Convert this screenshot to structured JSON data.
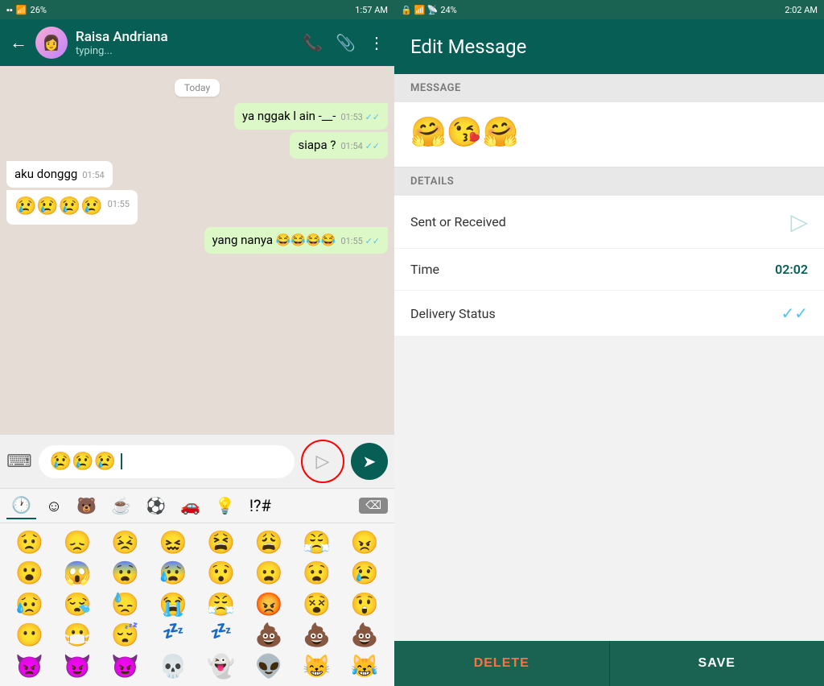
{
  "left": {
    "statusBar": {
      "left": "1:57 AM",
      "battery": "26%",
      "signal": "WiFi"
    },
    "topBar": {
      "contactName": "Raisa Andriana",
      "status": "typing...",
      "backIcon": "←",
      "callIcon": "📞",
      "attachIcon": "📎",
      "moreIcon": "⋮"
    },
    "todayLabel": "Today",
    "messages": [
      {
        "id": 1,
        "type": "sent",
        "text": "ya nggak l",
        "extra": "ain -__-",
        "time": "01:53",
        "ticks": "✓✓"
      },
      {
        "id": 2,
        "type": "sent",
        "text": "siapa ?",
        "time": "01:54",
        "ticks": "✓✓"
      },
      {
        "id": 3,
        "type": "received",
        "text": "aku donggg",
        "time": "01:54"
      },
      {
        "id": 4,
        "type": "received",
        "text": "😢😢😢😢",
        "time": "01:55"
      },
      {
        "id": 5,
        "type": "sent",
        "text": "yang nanya 😂😂😂😂",
        "time": "01:55",
        "ticks": "✓✓"
      }
    ],
    "inputBar": {
      "emojis": "😢😢😢",
      "stickerPlaceholder": "▷",
      "sendIcon": "➤",
      "keyboardIcon": "⌨"
    },
    "emojiTabs": [
      "🕐",
      "☺",
      "🐻",
      "☕",
      "⚽",
      "🚗",
      "💡",
      "!?#",
      "⌫"
    ],
    "emojiRows": [
      [
        "😟",
        "😞",
        "😣",
        "😖",
        "😫",
        "😩",
        "😤",
        "😠"
      ],
      [
        "😮",
        "😱",
        "😨",
        "😰",
        "😯",
        "😦",
        "😧",
        "😢"
      ],
      [
        "😥",
        "😪",
        "😓",
        "😭",
        "😤",
        "😡",
        "😵",
        "😲"
      ],
      [
        "😶",
        "😷",
        "😴",
        "💤",
        "💤",
        "💩",
        "💩",
        "💩"
      ],
      [
        "👿",
        "😈",
        "😈",
        "💀",
        "👻",
        "👽",
        "😸",
        "😹"
      ]
    ]
  },
  "right": {
    "statusBar": {
      "left": "2:02 AM",
      "battery": "24%"
    },
    "title": "Edit Message",
    "messageSectionLabel": "MESSAGE",
    "messageContent": "🤗😘🤗",
    "detailsSectionLabel": "DETAILS",
    "details": [
      {
        "label": "Sent or Received",
        "valueType": "icon",
        "icon": "▷"
      },
      {
        "label": "Time",
        "value": "02:02",
        "valueType": "text"
      },
      {
        "label": "Delivery Status",
        "valueType": "check",
        "icon": "✓✓"
      }
    ],
    "buttons": {
      "delete": "DELETE",
      "save": "SAVE"
    }
  }
}
